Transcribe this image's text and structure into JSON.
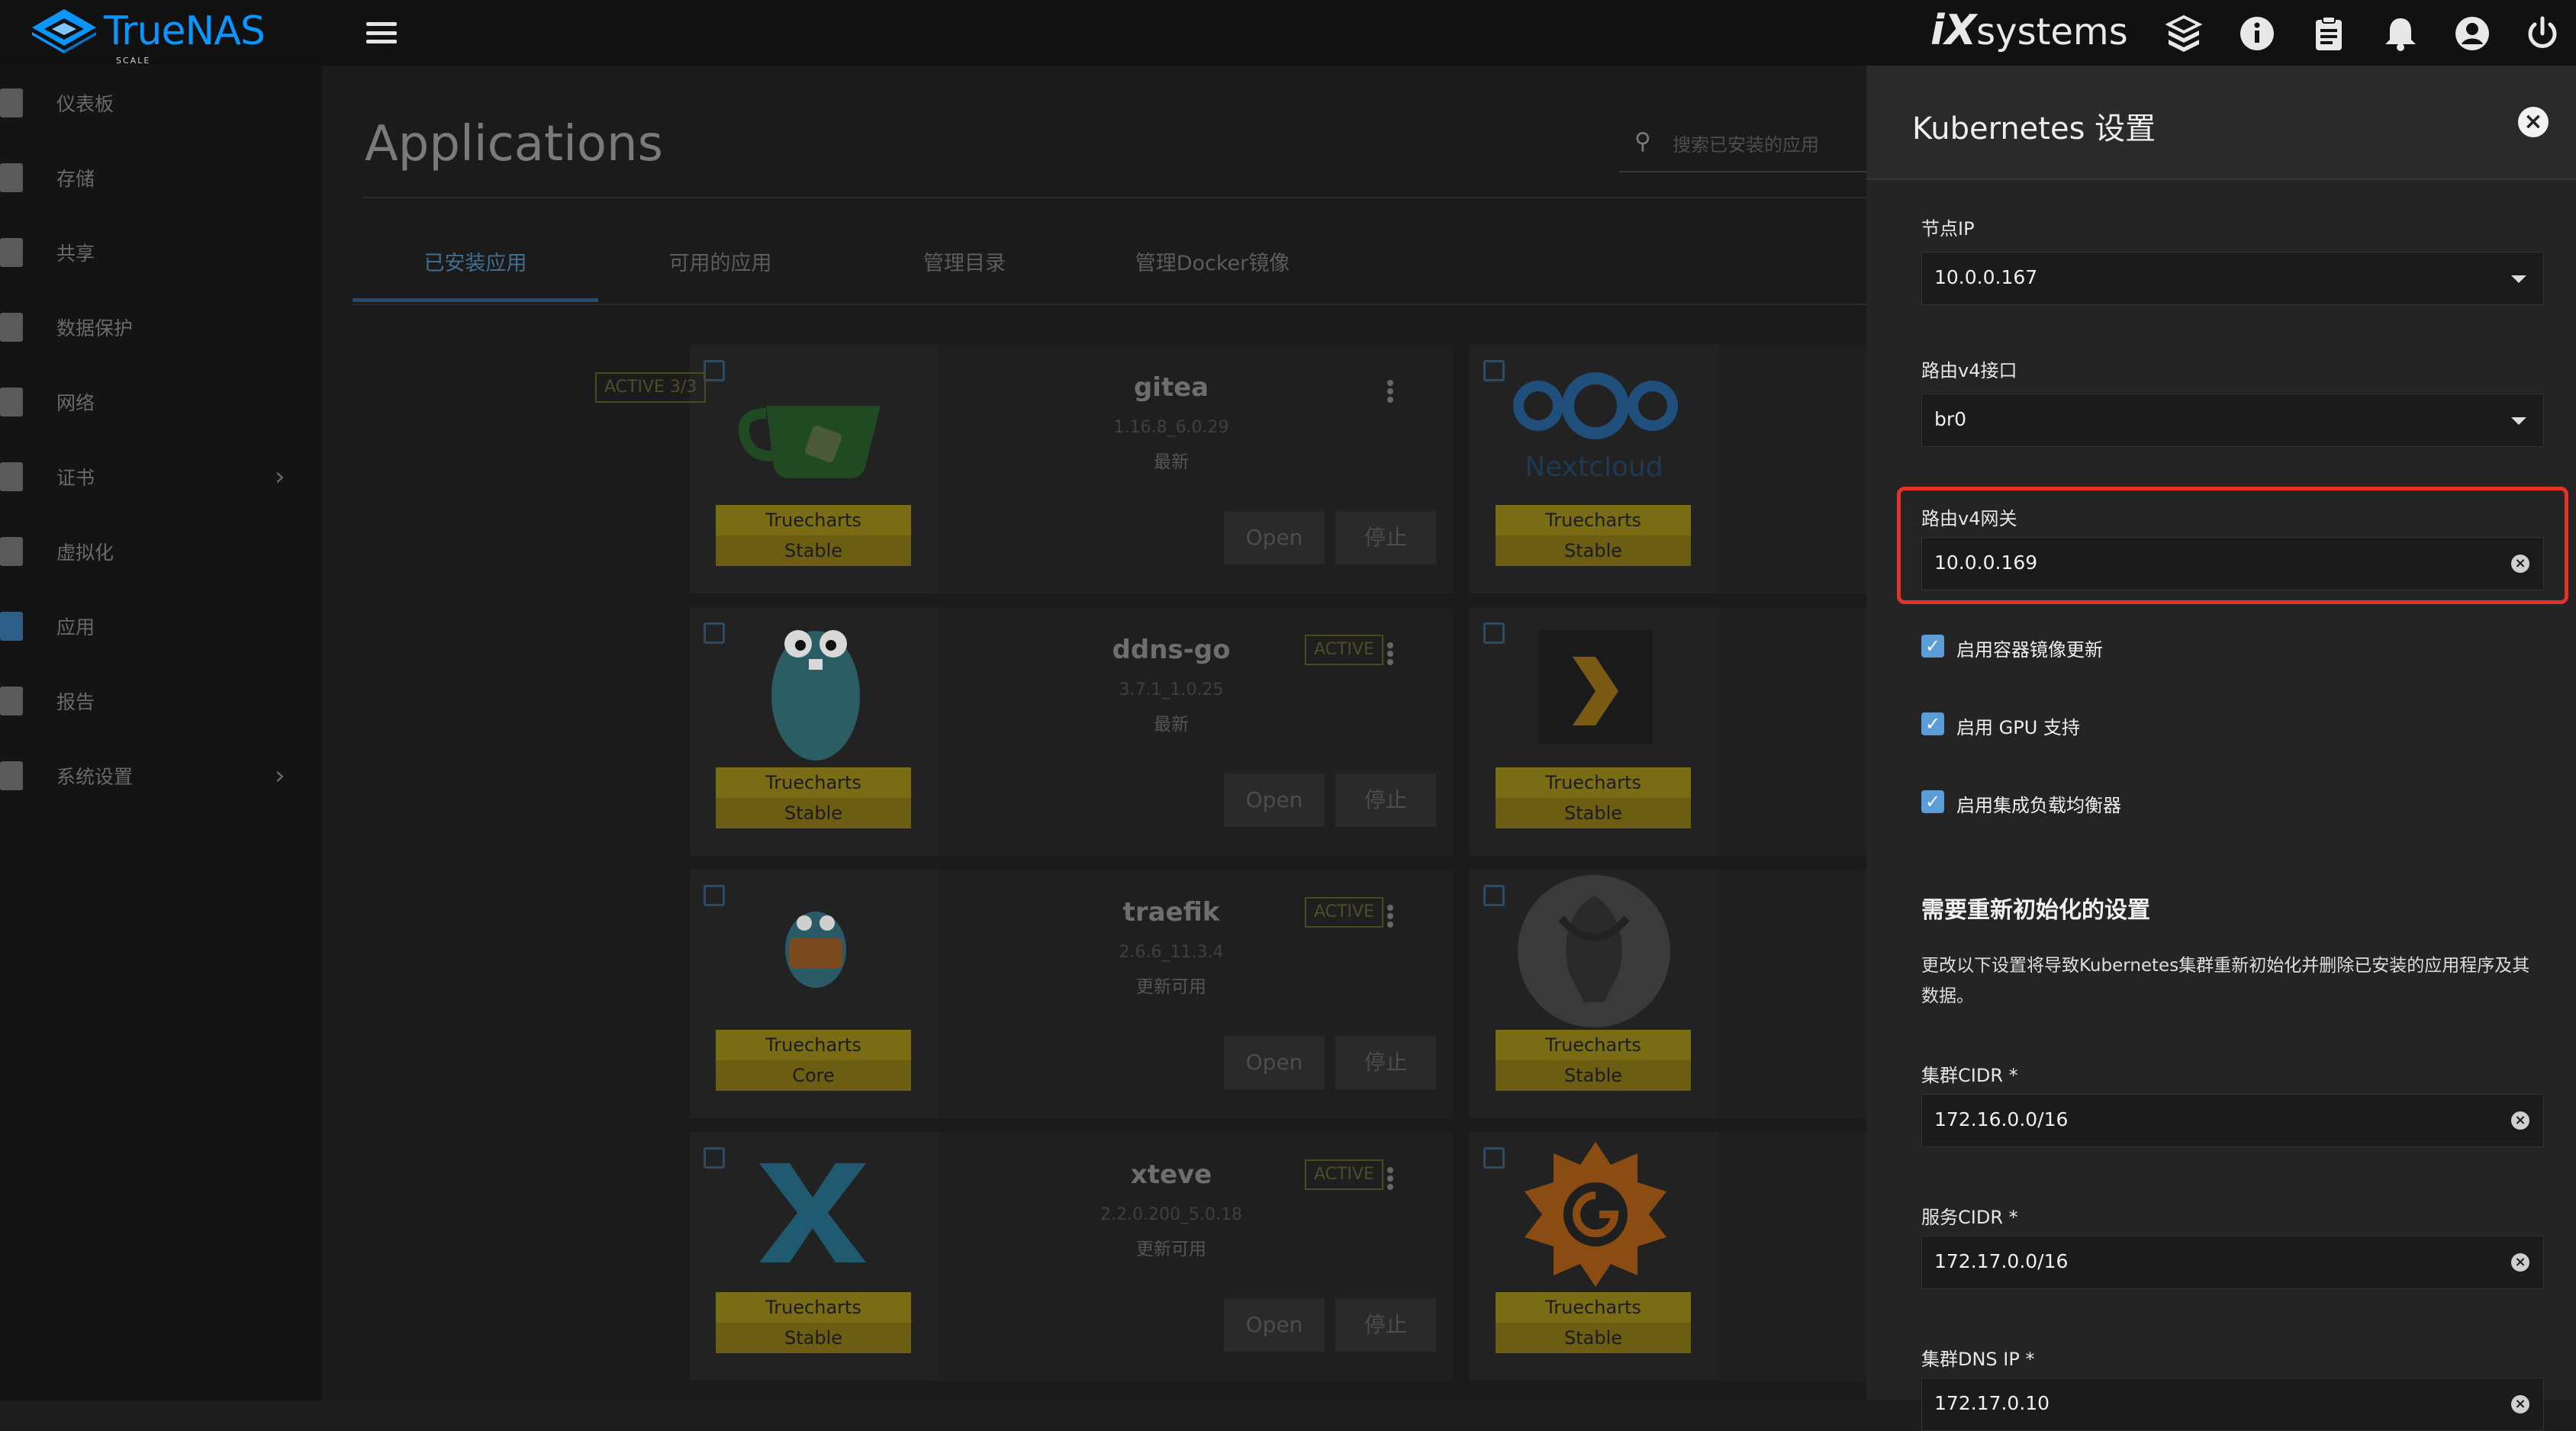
{
  "header": {
    "brand": "TrueNAS",
    "brand_sub": "SCALE",
    "vendor_prefix": "iX",
    "vendor_name": "systems",
    "icons": [
      "truecommand-icon",
      "info-icon",
      "clipboard-icon",
      "bell-icon",
      "account-icon",
      "power-icon"
    ]
  },
  "sidebar": {
    "items": [
      {
        "label": "仪表板",
        "icon": "dashboard-icon"
      },
      {
        "label": "存储",
        "icon": "storage-icon"
      },
      {
        "label": "共享",
        "icon": "share-icon"
      },
      {
        "label": "数据保护",
        "icon": "shield-icon"
      },
      {
        "label": "网络",
        "icon": "network-icon"
      },
      {
        "label": "证书",
        "icon": "key-icon"
      },
      {
        "label": "虚拟化",
        "icon": "laptop-icon"
      },
      {
        "label": "应用",
        "icon": "apps-icon"
      },
      {
        "label": "报告",
        "icon": "chart-icon"
      },
      {
        "label": "系统设置",
        "icon": "gear-icon"
      }
    ]
  },
  "main": {
    "title": "Applications",
    "search_placeholder": "搜索已安装的应用",
    "tabs": [
      "已安装应用",
      "可用的应用",
      "管理目录",
      "管理Docker镜像"
    ],
    "apps": [
      {
        "name": "gitea",
        "version": "1.16.8_6.0.29",
        "update": "最新",
        "status": "ACTIVE 3/3",
        "train": "Truecharts",
        "channel": "Stable",
        "open": "Open",
        "stop": "停止"
      },
      {
        "name": "ddns-go",
        "version": "3.7.1_1.0.25",
        "update": "最新",
        "status": "ACTIVE",
        "train": "Truecharts",
        "channel": "Stable",
        "open": "Open",
        "stop": "停止"
      },
      {
        "name": "traefik",
        "version": "2.6.6_11.3.4",
        "update": "更新可用",
        "status": "ACTIVE",
        "train": "Truecharts",
        "channel": "Core",
        "open": "Open",
        "stop": "停止"
      },
      {
        "name": "xteve",
        "version": "2.2.0.200_5.0.18",
        "update": "更新可用",
        "status": "ACTIVE",
        "train": "Truecharts",
        "channel": "Stable",
        "open": "Open",
        "stop": "停止"
      }
    ],
    "right_apps": [
      {
        "train": "Truecharts",
        "channel": "Stable",
        "logo_text": "Nextcloud"
      },
      {
        "train": "Truecharts",
        "channel": "Stable"
      },
      {
        "train": "Truecharts",
        "channel": "Stable"
      },
      {
        "train": "Truecharts",
        "channel": "Stable"
      }
    ]
  },
  "panel": {
    "title": "Kubernetes 设置",
    "node_ip_label": "节点IP",
    "node_ip_value": "10.0.0.167",
    "route_v4_iface_label": "路由v4接口",
    "route_v4_iface_value": "br0",
    "route_v4_gw_label": "路由v4网关",
    "route_v4_gw_value": "10.0.0.169",
    "checkboxes": [
      {
        "label": "启用容器镜像更新",
        "checked": true
      },
      {
        "label": "启用 GPU 支持",
        "checked": true
      },
      {
        "label": "启用集成负载均衡器",
        "checked": true
      }
    ],
    "reinit_title": "需要重新初始化的设置",
    "reinit_desc": "更改以下设置将导致Kubernetes集群重新初始化并删除已安装的应用程序及其数据。",
    "cluster_cidr_label": "集群CIDR *",
    "cluster_cidr_value": "172.16.0.0/16",
    "service_cidr_label": "服务CIDR *",
    "service_cidr_value": "172.17.0.0/16",
    "cluster_dns_label": "集群DNS IP *",
    "cluster_dns_value": "172.17.0.10",
    "accent": "#5b9dd6",
    "highlight_color": "#e4312a"
  }
}
